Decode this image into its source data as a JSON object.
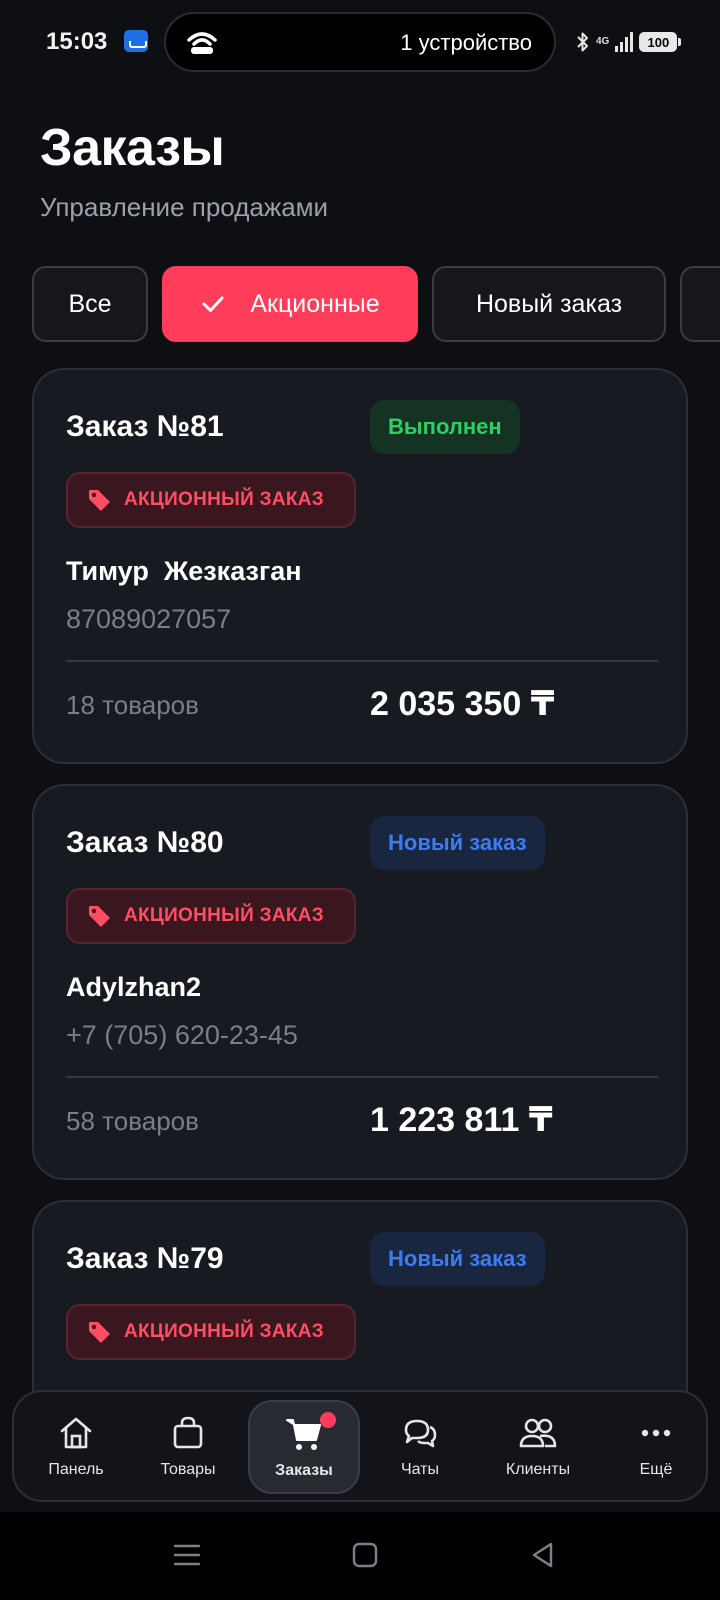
{
  "statusbar": {
    "time": "15:03",
    "hotspot_text": "1 устройство",
    "network": "4G",
    "battery": "100"
  },
  "header": {
    "title": "Заказы",
    "subtitle": "Управление продажами"
  },
  "filters": [
    {
      "label": "Все",
      "active": false
    },
    {
      "label": "Акционные",
      "active": true
    },
    {
      "label": "Новый заказ",
      "active": false
    }
  ],
  "promo_label": "АКЦИОННЫЙ ЗАКАЗ",
  "orders": [
    {
      "title": "Заказ №81",
      "status": "Выполнен",
      "status_color": "#2fce64",
      "client": "Тимур  Жезказган",
      "phone": "87089027057",
      "items": "18 товаров",
      "total": "2 035 350 ₸"
    },
    {
      "title": "Заказ №80",
      "status": "Новый заказ",
      "status_color": "#3d7cf0",
      "client": "Adylzhan2",
      "phone": "+7 (705) 620-23-45",
      "items": "58 товаров",
      "total": "1 223 811 ₸"
    },
    {
      "title": "Заказ №79",
      "status": "Новый заказ",
      "status_color": "#3d7cf0"
    }
  ],
  "nav": [
    {
      "label": "Панель",
      "icon": "home-icon"
    },
    {
      "label": "Товары",
      "icon": "bag-icon"
    },
    {
      "label": "Заказы",
      "icon": "cart-icon",
      "active": true
    },
    {
      "label": "Чаты",
      "icon": "chat-icon"
    },
    {
      "label": "Клиенты",
      "icon": "users-icon"
    },
    {
      "label": "Ещё",
      "icon": "more-icon"
    }
  ],
  "colors": {
    "accent": "#ff3d5a",
    "background": "#0d0f13",
    "card": "#171a20"
  }
}
